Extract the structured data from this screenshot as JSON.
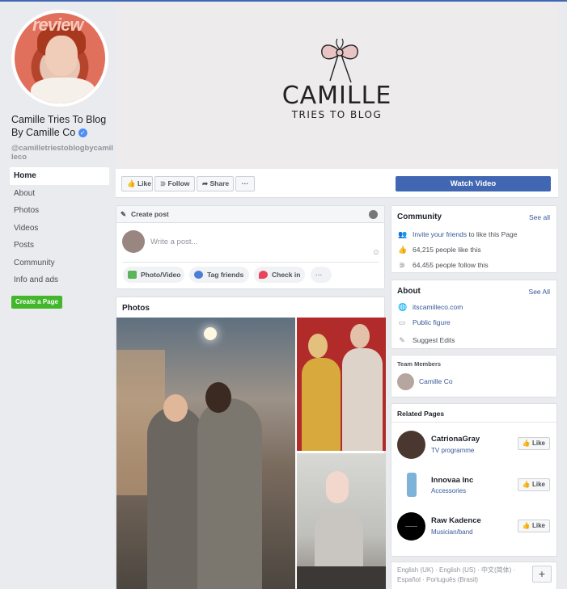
{
  "profile": {
    "name": "Camille Tries To Blog By Camille Co",
    "verified_mark": "✓",
    "handle": "@camilletriestoblogbycamilleco",
    "avatar_overlay_text": "review"
  },
  "nav": {
    "items": [
      "Home",
      "About",
      "Photos",
      "Videos",
      "Posts",
      "Community",
      "Info and ads"
    ],
    "active": "Home",
    "create_page": "Create a Page"
  },
  "cover": {
    "logo_main": "CAMILLE",
    "logo_sub": "TRIES TO BLOG"
  },
  "actions": {
    "like": "Like",
    "follow": "Follow",
    "share": "Share",
    "more": "···",
    "watch_video": "Watch Video"
  },
  "create_post": {
    "header": "Create post",
    "placeholder": "Write a post...",
    "buttons": [
      "Photo/Video",
      "Tag friends",
      "Check in"
    ],
    "more": "···"
  },
  "photos": {
    "title": "Photos"
  },
  "community": {
    "title": "Community",
    "see_all": "See all",
    "invite_link": "Invite your friends",
    "invite_rest": "to like this Page",
    "likes": "64,215 people like this",
    "follows": "64,455 people follow this"
  },
  "about": {
    "title": "About",
    "see_all": "See All",
    "website": "itscamilleco.com",
    "category": "Public figure",
    "suggest": "Suggest Edits"
  },
  "team": {
    "title": "Team Members",
    "member": "Camille Co"
  },
  "related": {
    "title": "Related Pages",
    "like_label": "Like",
    "pages": [
      {
        "name": "CatrionaGray",
        "category": "TV programme"
      },
      {
        "name": "Innovaa Inc",
        "category": "Accessories"
      },
      {
        "name": "Raw Kadence",
        "category": "Musician/band"
      }
    ]
  },
  "footer": {
    "langs_line1": "English (UK) · English (US) · 中文(简体) ·",
    "langs_line2": "Español · Português (Brasil)",
    "add": "+"
  },
  "colors": {
    "facebook_blue": "#4267b2",
    "link": "#385898",
    "create_page_green": "#42b72a",
    "background": "#e9ebee"
  }
}
